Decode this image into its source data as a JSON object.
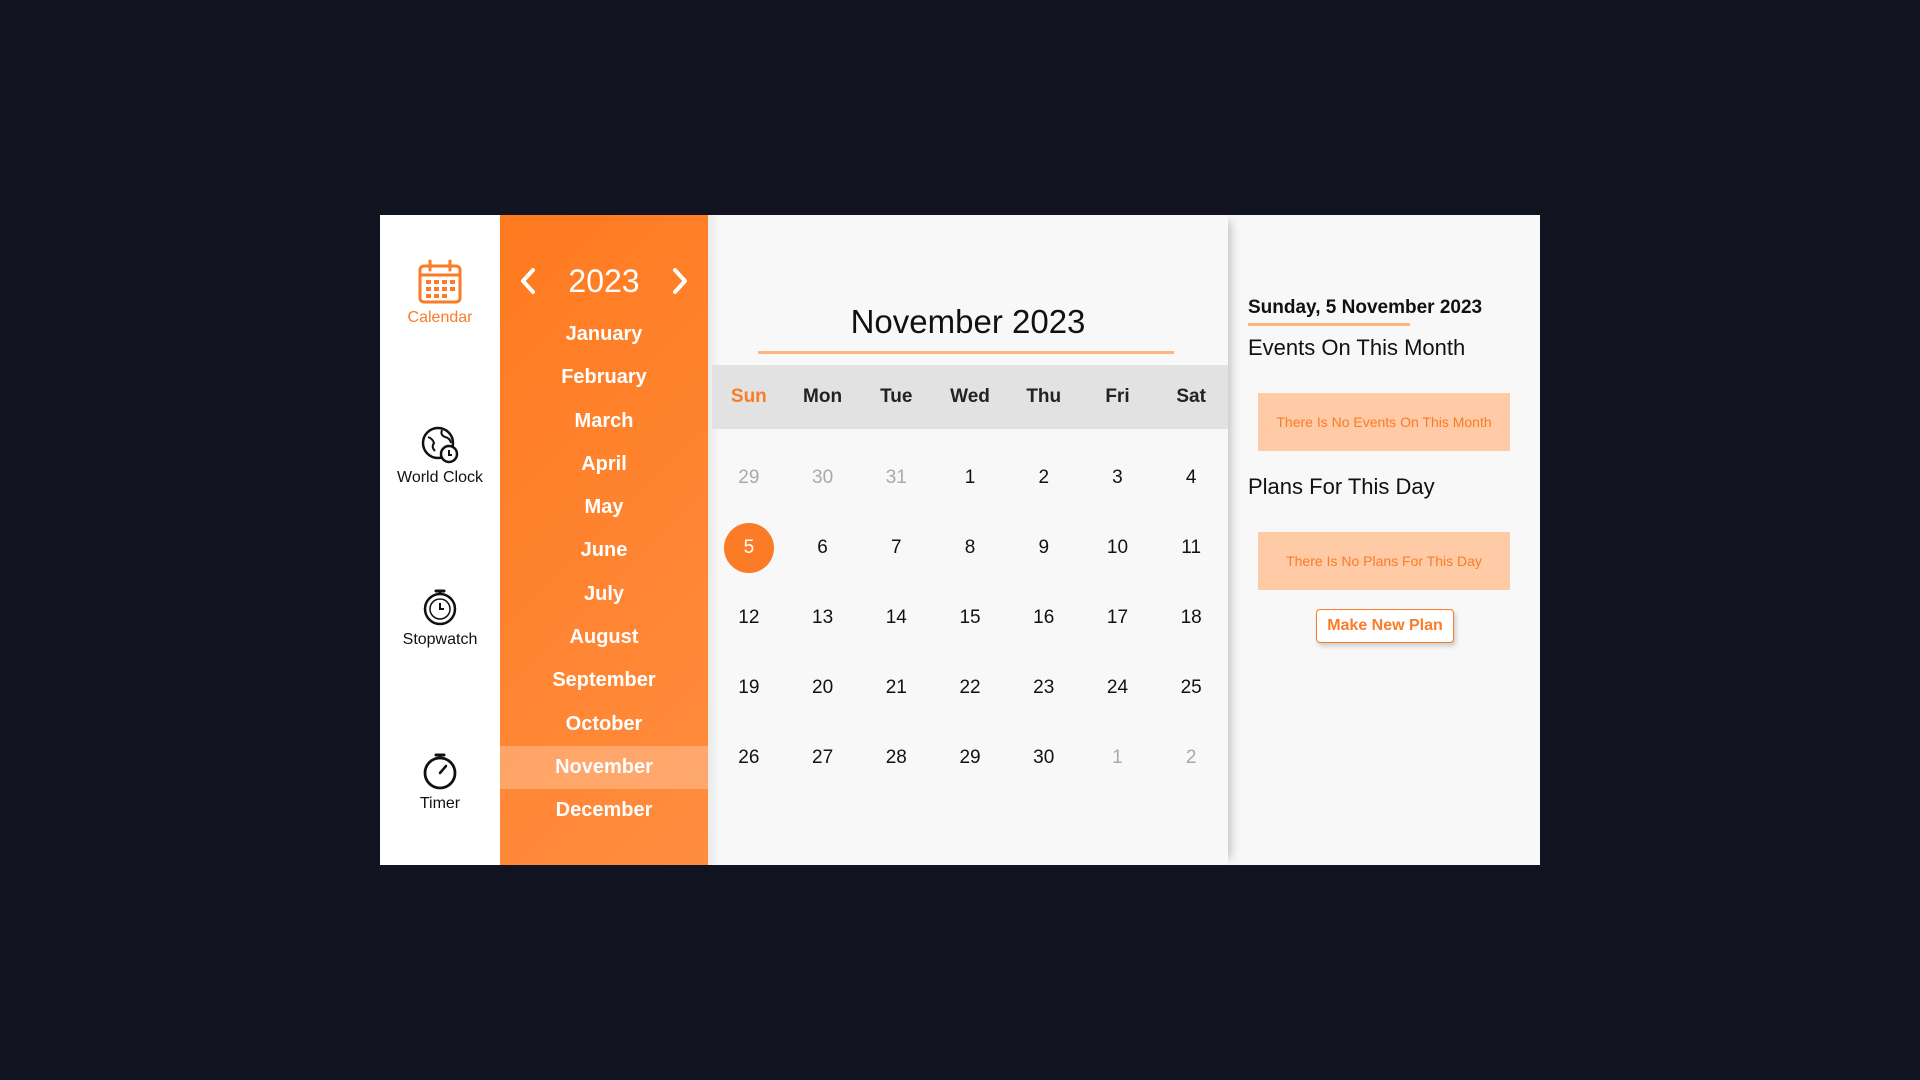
{
  "nav": {
    "items": [
      {
        "label": "Calendar",
        "icon": "calendar-icon",
        "active": true
      },
      {
        "label": "World Clock",
        "icon": "world-clock-icon",
        "active": false
      },
      {
        "label": "Stopwatch",
        "icon": "stopwatch-icon",
        "active": false
      },
      {
        "label": "Timer",
        "icon": "timer-icon",
        "active": false
      }
    ]
  },
  "year_picker": {
    "year": "2023",
    "prev_icon": "chevron-left-icon",
    "next_icon": "chevron-right-icon"
  },
  "months": [
    "January",
    "February",
    "March",
    "April",
    "May",
    "June",
    "July",
    "August",
    "September",
    "October",
    "November",
    "December"
  ],
  "selected_month": "November",
  "calendar": {
    "title": "November 2023",
    "weekdays": [
      "Sun",
      "Mon",
      "Tue",
      "Wed",
      "Thu",
      "Fri",
      "Sat"
    ],
    "weeks": [
      [
        {
          "d": "29",
          "other": true
        },
        {
          "d": "30",
          "other": true
        },
        {
          "d": "31",
          "other": true
        },
        {
          "d": "1"
        },
        {
          "d": "2"
        },
        {
          "d": "3"
        },
        {
          "d": "4"
        }
      ],
      [
        {
          "d": "5",
          "today": true
        },
        {
          "d": "6"
        },
        {
          "d": "7"
        },
        {
          "d": "8"
        },
        {
          "d": "9"
        },
        {
          "d": "10"
        },
        {
          "d": "11"
        }
      ],
      [
        {
          "d": "12"
        },
        {
          "d": "13"
        },
        {
          "d": "14"
        },
        {
          "d": "15"
        },
        {
          "d": "16"
        },
        {
          "d": "17"
        },
        {
          "d": "18"
        }
      ],
      [
        {
          "d": "19"
        },
        {
          "d": "20"
        },
        {
          "d": "21"
        },
        {
          "d": "22"
        },
        {
          "d": "23"
        },
        {
          "d": "24"
        },
        {
          "d": "25"
        }
      ],
      [
        {
          "d": "26"
        },
        {
          "d": "27"
        },
        {
          "d": "28"
        },
        {
          "d": "29"
        },
        {
          "d": "30"
        },
        {
          "d": "1",
          "other": true
        },
        {
          "d": "2",
          "other": true
        }
      ]
    ]
  },
  "side": {
    "date": "Sunday, 5 November 2023",
    "events_heading": "Events On This Month",
    "events_empty": "There Is No Events On This Month",
    "plans_heading": "Plans For This Day",
    "plans_empty": "There Is No Plans For This Day",
    "make_plan_label": "Make New Plan"
  },
  "colors": {
    "accent": "#fb7b26",
    "background": "#121321",
    "muted_box": "#ffcaa6"
  }
}
